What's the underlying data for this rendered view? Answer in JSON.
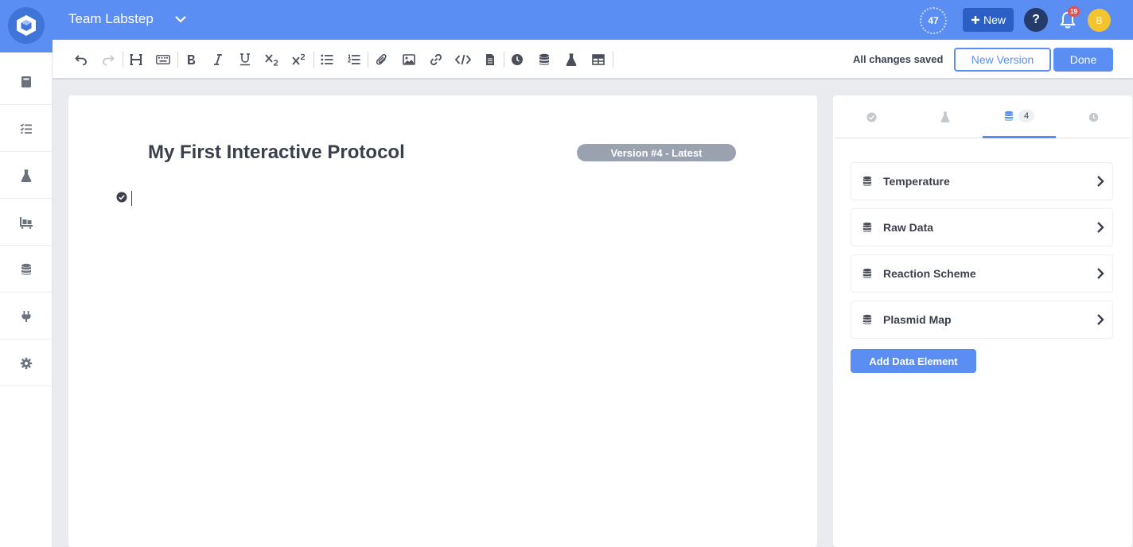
{
  "header": {
    "team_name": "Team Labstep",
    "counter": "47",
    "new_label": "New",
    "help_label": "?",
    "notifications_count": "19",
    "avatar_initial": "B",
    "brand_color": "#5a8ef2"
  },
  "sidebar": {
    "items": [
      {
        "icon": "book-icon"
      },
      {
        "icon": "checklist-icon"
      },
      {
        "icon": "flask-icon"
      },
      {
        "icon": "inventory-icon"
      },
      {
        "icon": "database-icon"
      },
      {
        "icon": "plug-icon"
      },
      {
        "icon": "gear-icon"
      }
    ]
  },
  "toolbar": {
    "status": "All changes saved",
    "new_version_label": "New Version",
    "done_label": "Done"
  },
  "editor": {
    "title": "My First Interactive Protocol",
    "version_label": "Version #4 - Latest"
  },
  "panel": {
    "tabs": [
      {
        "icon": "check-circle-icon",
        "count": ""
      },
      {
        "icon": "flask-icon",
        "count": ""
      },
      {
        "icon": "database-icon",
        "count": "4"
      },
      {
        "icon": "clock-icon",
        "count": ""
      }
    ],
    "active_tab": 2,
    "data_elements": [
      {
        "label": "Temperature"
      },
      {
        "label": "Raw Data"
      },
      {
        "label": "Reaction Scheme"
      },
      {
        "label": "Plasmid Map"
      }
    ],
    "add_label": "Add Data Element"
  }
}
